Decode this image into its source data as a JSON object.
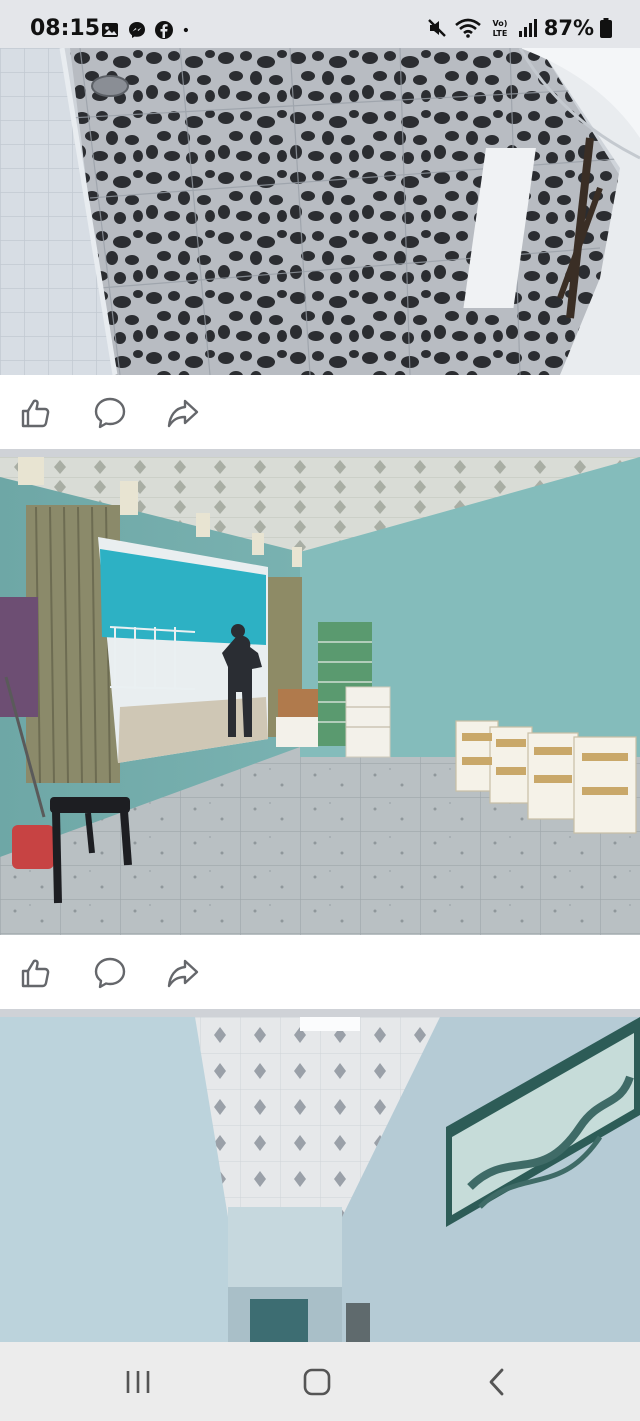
{
  "status_bar": {
    "time": "08:15",
    "app_icons": [
      "gallery-icon",
      "messenger-icon",
      "facebook-icon",
      "dot-icon"
    ],
    "system_icons": [
      "mute-icon",
      "wifi-icon",
      "volte-icon",
      "signal-icon"
    ],
    "battery": "87%"
  },
  "feed": {
    "photos": [
      {
        "subject": "bathroom-floor-pebble-tiles"
      },
      {
        "subject": "empty-room-with-boxes"
      },
      {
        "subject": "hallway-with-window"
      }
    ],
    "actions": [
      "like-icon",
      "comment-icon",
      "share-icon"
    ]
  },
  "nav_bar": {
    "buttons": [
      "recent-apps-button",
      "home-button",
      "back-button"
    ]
  },
  "colors": {
    "status_bg": "#e4e6ea",
    "action_bg": "#ffffff",
    "icon": "#65676b",
    "wall_teal": "#7fb6b5"
  }
}
